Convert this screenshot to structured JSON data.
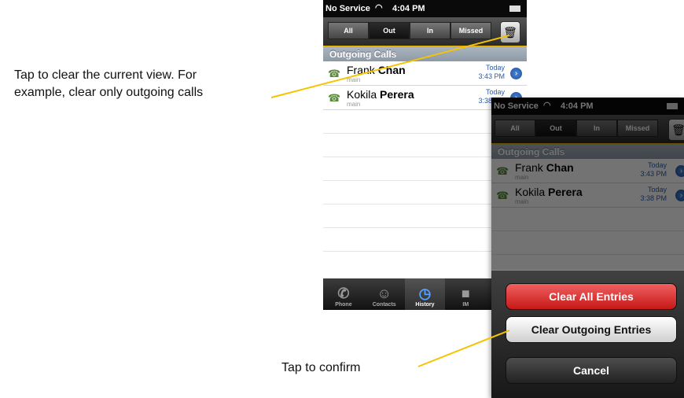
{
  "callouts": {
    "clear_view_line1": "Tap to clear the current view. For",
    "clear_view_line2": "example, clear only outgoing calls",
    "confirm": "Tap to confirm"
  },
  "status_bar": {
    "carrier": "No Service",
    "time": "4:04 PM"
  },
  "segments": {
    "all": "All",
    "out": "Out",
    "in": "In",
    "missed": "Missed",
    "selected": "Out"
  },
  "section_title": "Outgoing Calls",
  "calls": [
    {
      "first": "Frank",
      "last": "Chan",
      "type": "main",
      "day": "Today",
      "time": "3:43 PM"
    },
    {
      "first": "Kokila",
      "last": "Perera",
      "type": "main",
      "day": "Today",
      "time": "3:38 PM"
    }
  ],
  "tabs": {
    "phone": "Phone",
    "contacts": "Contacts",
    "history": "History",
    "im": "IM"
  },
  "action_sheet": {
    "clear_all": "Clear All Entries",
    "clear_outgoing": "Clear Outgoing Entries",
    "cancel": "Cancel"
  },
  "colors": {
    "accent_line": "#f5c400",
    "destructive": "#d9282a",
    "link_blue": "#2a5ca8"
  },
  "icons": [
    "wifi-icon",
    "battery-icon",
    "trash-icon",
    "phone-call-icon",
    "disclosure-icon",
    "phone-icon",
    "contacts-icon",
    "history-clock-icon",
    "im-bubble-icon"
  ]
}
